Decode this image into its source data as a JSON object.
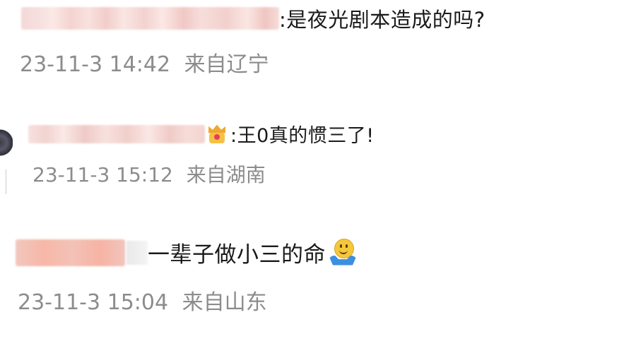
{
  "comments": [
    {
      "username": "",
      "text": ":是夜光剧本造成的吗?",
      "timestamp": "23-11-3 14:42",
      "location": "来自辽宁"
    },
    {
      "username": "",
      "badge_icon": "crown-badge-icon",
      "text": ":王0真的惯三了!",
      "timestamp": "23-11-3 15:12",
      "location": "来自湖南"
    },
    {
      "username": "",
      "text": "一辈子做小三的命",
      "emoji_icon": "shrug-smile-emoji-icon",
      "timestamp": "23-11-3 15:04",
      "location": "来自山东"
    }
  ],
  "colors": {
    "text": "#1a1a1a",
    "meta": "#8c8c8c",
    "background": "#ffffff"
  }
}
